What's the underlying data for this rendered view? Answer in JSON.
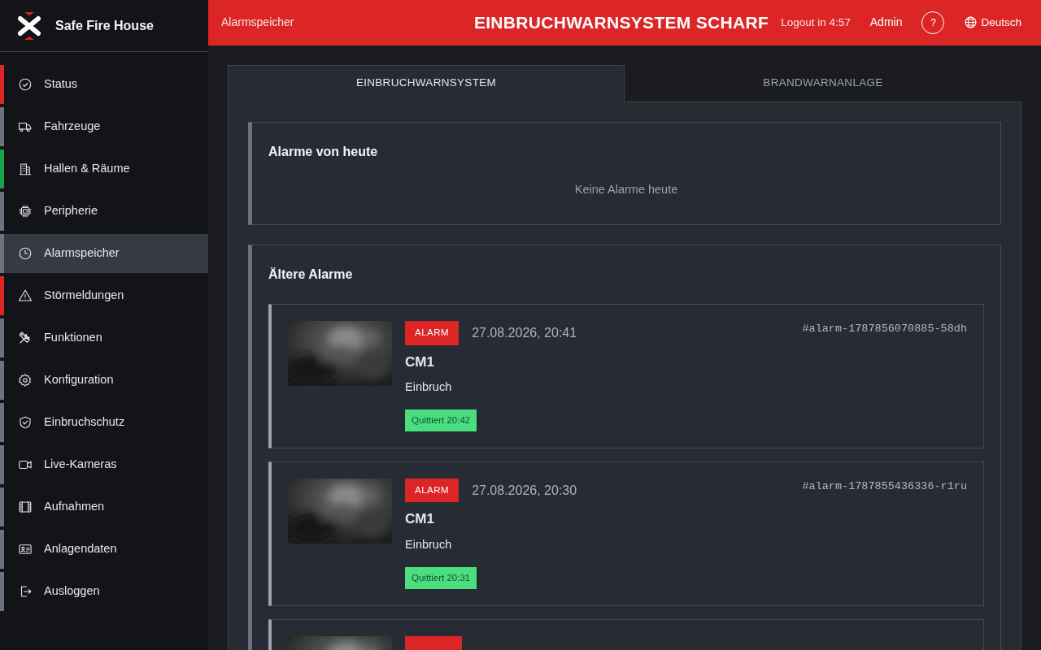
{
  "brand": {
    "name": "Safe Fire House"
  },
  "sidebar": {
    "items": [
      {
        "label": "Status",
        "color": "#dc2626",
        "selected": false
      },
      {
        "label": "Fahrzeuge",
        "color": "#6b7280",
        "selected": false
      },
      {
        "label": "Hallen & Räume",
        "color": "#16a34a",
        "selected": false
      },
      {
        "label": "Peripherie",
        "color": "#6b7280",
        "selected": false
      },
      {
        "label": "Alarmspeicher",
        "color": "#6b7280",
        "selected": true
      },
      {
        "label": "Störmeldungen",
        "color": "#dc2626",
        "selected": false
      },
      {
        "label": "Funktionen",
        "color": "#6b7280",
        "selected": false
      },
      {
        "label": "Konfiguration",
        "color": "#6b7280",
        "selected": false
      },
      {
        "label": "Einbruchschutz",
        "color": "#6b7280",
        "selected": false
      },
      {
        "label": "Live-Kameras",
        "color": "#6b7280",
        "selected": false
      },
      {
        "label": "Aufnahmen",
        "color": "#6b7280",
        "selected": false
      },
      {
        "label": "Anlagendaten",
        "color": "#6b7280",
        "selected": false
      },
      {
        "label": "Ausloggen",
        "color": "#6b7280",
        "selected": false
      }
    ]
  },
  "header": {
    "page": "Alarmspeicher",
    "status": "EINBRUCHWARNSYSTEM SCHARF",
    "logout_timer": "Logout in 4:57",
    "user": "Admin",
    "help": "?",
    "language": "Deutsch"
  },
  "tabs": [
    {
      "label": "EINBRUCHWARNSYSTEM",
      "selected": true
    },
    {
      "label": "BRANDWARNANLAGE",
      "selected": false
    }
  ],
  "today": {
    "title": "Alarme von heute",
    "empty": "Keine Alarme heute"
  },
  "older": {
    "title": "Ältere Alarme",
    "alarms": [
      {
        "badge": "ALARM",
        "datetime": "27.08.2026, 20:41",
        "id": "#alarm-1787856070885-58dh",
        "name": "CM1",
        "category": "Einbruch",
        "ack": "Quittiert 20:42"
      },
      {
        "badge": "ALARM",
        "datetime": "27.08.2026, 20:30",
        "id": "#alarm-1787855436336-r1ru",
        "name": "CM1",
        "category": "Einbruch",
        "ack": "Quittiert 20:31"
      },
      {
        "kind": "picture"
      }
    ]
  }
}
